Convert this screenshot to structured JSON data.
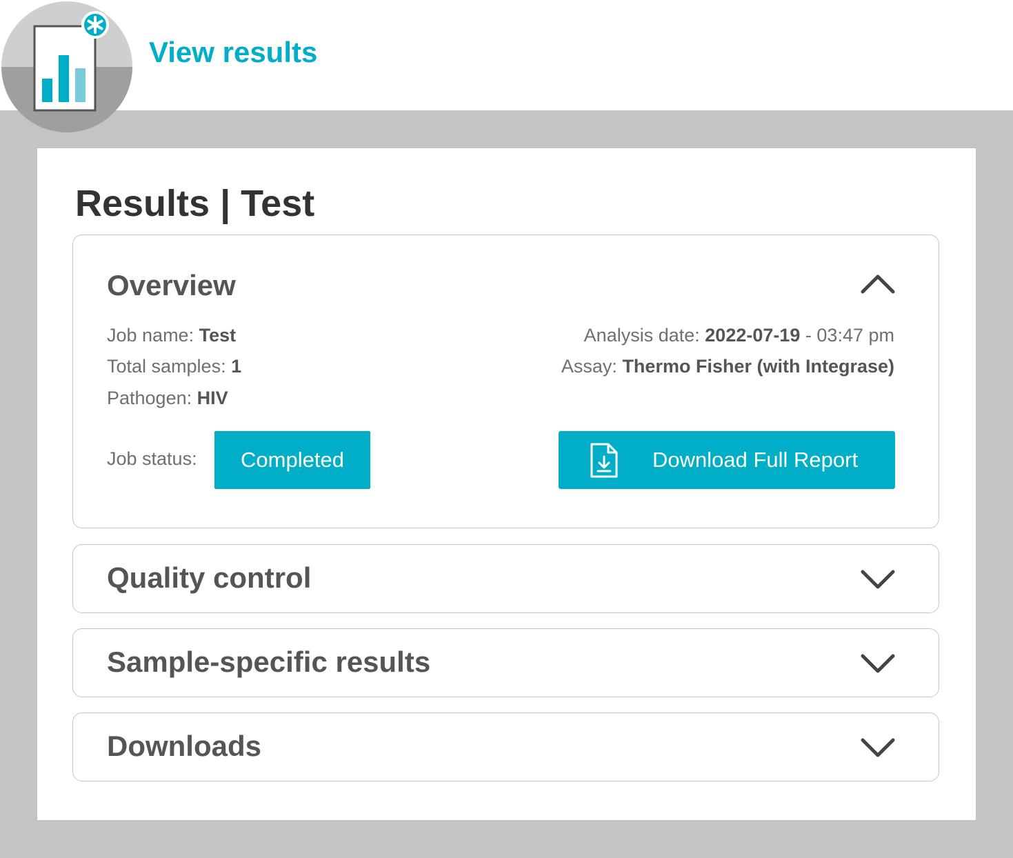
{
  "header": {
    "title": "View results",
    "logo_icon": "results-report-icon",
    "accent_color": "#00aec7"
  },
  "page": {
    "title": "Results | Test"
  },
  "overview": {
    "title": "Overview",
    "expanded": true,
    "job_name_label": "Job name:",
    "job_name": "Test",
    "total_samples_label": "Total samples:",
    "total_samples": "1",
    "pathogen_label": "Pathogen:",
    "pathogen": "HIV",
    "analysis_date_label": "Analysis date:",
    "analysis_date": "2022-07-19",
    "analysis_time": "- 03:47 pm",
    "assay_label": "Assay:",
    "assay": "Thermo Fisher (with Integrase)",
    "job_status_label": "Job status:",
    "job_status": "Completed",
    "download_label": "Download Full Report",
    "download_icon": "file-download-icon"
  },
  "sections": [
    {
      "title": "Quality control",
      "expanded": false
    },
    {
      "title": "Sample-specific results",
      "expanded": false
    },
    {
      "title": "Downloads",
      "expanded": false
    }
  ],
  "icons": {
    "collapse": "chevron-up-icon",
    "expand": "chevron-down-icon"
  }
}
